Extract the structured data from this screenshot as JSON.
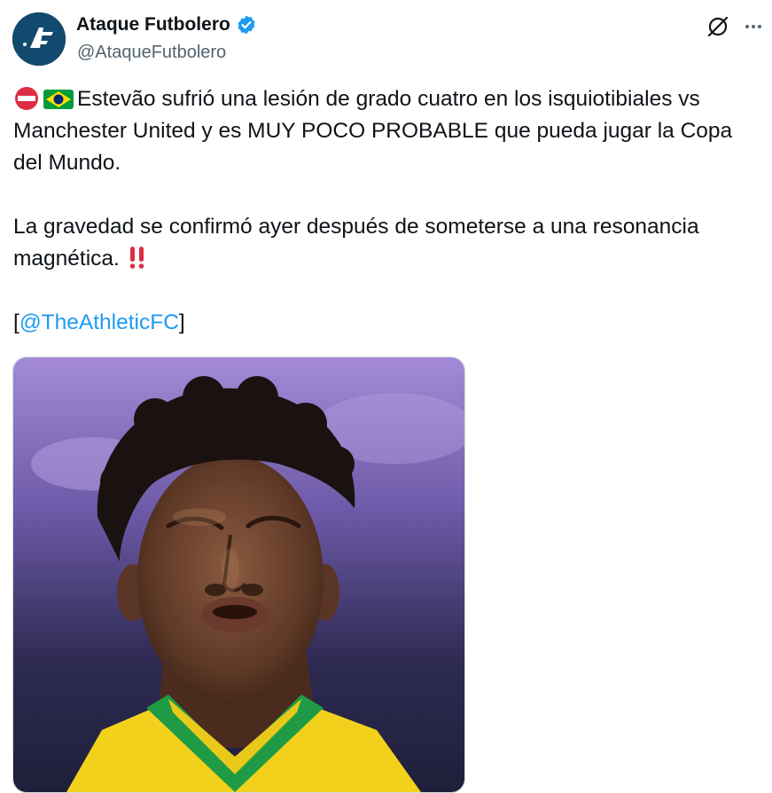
{
  "author": {
    "display_name": "Ataque Futbolero",
    "handle": "@AtaqueFutbolero",
    "avatar_letters": "AF",
    "verified": true
  },
  "header_actions": {
    "grok_icon": "grok-slash-circle-icon",
    "more_icon": "more-horizontal-icon"
  },
  "tweet": {
    "line1_text": "Estevão sufrió una lesión de grado cuatro en los isquiotibiales vs Manchester United y es MUY POCO PROBABLE que pueda jugar la Copa del Mundo.",
    "line2_text": "La gravedad se confirmó ayer después de someterse a una resonancia magnética.",
    "source_open": "[",
    "source_mention": "@TheAthleticFC",
    "source_close": "]",
    "emojis": [
      "no-entry",
      "brazil-flag",
      "double-exclamation"
    ]
  },
  "media": {
    "type": "photo"
  },
  "colors": {
    "accent": "#1d9bf0",
    "text": "#0f1419",
    "muted": "#536471"
  }
}
